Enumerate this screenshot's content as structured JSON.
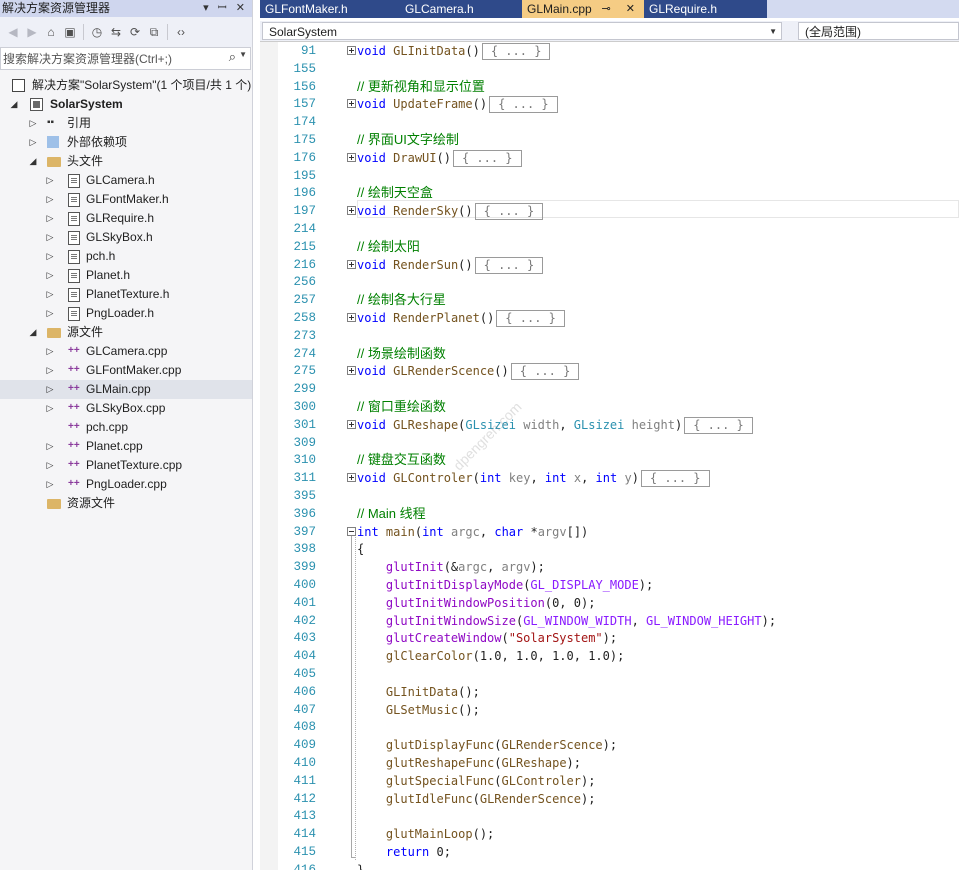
{
  "solution_explorer": {
    "title": "解决方案资源管理器",
    "title_buttons": [
      "▾",
      "ꟷ",
      "✕"
    ],
    "search_placeholder": "搜索解决方案资源管理器(Ctrl+;)",
    "tree": [
      {
        "label": "解决方案\"SolarSystem\"(1 个项目/共 1 个)",
        "depth": 0,
        "icon": "solution-icon",
        "arrow": ""
      },
      {
        "label": "SolarSystem",
        "depth": 1,
        "icon": "project-icon",
        "arrow": "◢",
        "bold": true
      },
      {
        "label": "引用",
        "depth": 2,
        "icon": "reference-icon",
        "arrow": "▷"
      },
      {
        "label": "外部依赖项",
        "depth": 2,
        "icon": "external-deps-icon",
        "arrow": "▷"
      },
      {
        "label": "头文件",
        "depth": 2,
        "icon": "folder-icon",
        "arrow": "◢"
      },
      {
        "label": "GLCamera.h",
        "depth": 3,
        "icon": "header-file-icon",
        "arrow": "▷"
      },
      {
        "label": "GLFontMaker.h",
        "depth": 3,
        "icon": "header-file-icon",
        "arrow": "▷"
      },
      {
        "label": "GLRequire.h",
        "depth": 3,
        "icon": "header-file-icon",
        "arrow": "▷"
      },
      {
        "label": "GLSkyBox.h",
        "depth": 3,
        "icon": "header-file-icon",
        "arrow": "▷"
      },
      {
        "label": "pch.h",
        "depth": 3,
        "icon": "header-file-icon",
        "arrow": "▷"
      },
      {
        "label": "Planet.h",
        "depth": 3,
        "icon": "header-file-icon",
        "arrow": "▷"
      },
      {
        "label": "PlanetTexture.h",
        "depth": 3,
        "icon": "header-file-icon",
        "arrow": "▷"
      },
      {
        "label": "PngLoader.h",
        "depth": 3,
        "icon": "header-file-icon",
        "arrow": "▷"
      },
      {
        "label": "源文件",
        "depth": 2,
        "icon": "folder-icon",
        "arrow": "◢"
      },
      {
        "label": "GLCamera.cpp",
        "depth": 3,
        "icon": "cpp-file-icon",
        "arrow": "▷"
      },
      {
        "label": "GLFontMaker.cpp",
        "depth": 3,
        "icon": "cpp-file-icon",
        "arrow": "▷"
      },
      {
        "label": "GLMain.cpp",
        "depth": 3,
        "icon": "cpp-file-icon",
        "arrow": "▷",
        "selected": true
      },
      {
        "label": "GLSkyBox.cpp",
        "depth": 3,
        "icon": "cpp-file-icon",
        "arrow": "▷"
      },
      {
        "label": "pch.cpp",
        "depth": 3,
        "icon": "cpp-file-icon",
        "arrow": ""
      },
      {
        "label": "Planet.cpp",
        "depth": 3,
        "icon": "cpp-file-icon",
        "arrow": "▷"
      },
      {
        "label": "PlanetTexture.cpp",
        "depth": 3,
        "icon": "cpp-file-icon",
        "arrow": "▷"
      },
      {
        "label": "PngLoader.cpp",
        "depth": 3,
        "icon": "cpp-file-icon",
        "arrow": "▷"
      },
      {
        "label": "资源文件",
        "depth": 2,
        "icon": "folder-icon",
        "arrow": ""
      }
    ]
  },
  "tabs": [
    {
      "label": "GLFontMaker.h",
      "active": false
    },
    {
      "label": "GLCamera.h",
      "active": false
    },
    {
      "label": "GLMain.cpp",
      "active": true
    },
    {
      "label": "GLRequire.h",
      "active": false
    }
  ],
  "active_tab_icons": "⊸ ✕",
  "navbar": {
    "project": "SolarSystem",
    "scope": "(全局范围)"
  },
  "watermark": "dpengren.com",
  "code_lines": [
    {
      "n": "91",
      "fold": "plus",
      "html": "<span class='kw'>void</span> <span class='fn'>GLInitData</span>()<span class='collapsed'>{ ... }</span>"
    },
    {
      "n": "155",
      "html": ""
    },
    {
      "n": "156",
      "html": "<span class='cm'>// 更新视角和显示位置</span>"
    },
    {
      "n": "157",
      "fold": "plus",
      "html": "<span class='kw'>void</span> <span class='fn'>UpdateFrame</span>()<span class='collapsed'>{ ... }</span>"
    },
    {
      "n": "174",
      "html": ""
    },
    {
      "n": "175",
      "html": "<span class='cm'>// 界面UI文字绘制</span>"
    },
    {
      "n": "176",
      "fold": "plus",
      "html": "<span class='kw'>void</span> <span class='fn'>DrawUI</span>()<span class='collapsed'>{ ... }</span>"
    },
    {
      "n": "195",
      "html": ""
    },
    {
      "n": "196",
      "html": "<span class='cm'>// 绘制天空盒</span>"
    },
    {
      "n": "197",
      "fold": "plus",
      "html": "<span class='kw'>void</span> <span class='fn'>RenderSky</span>()<span class='collapsed'>{ ... }</span>"
    },
    {
      "n": "214",
      "html": ""
    },
    {
      "n": "215",
      "html": "<span class='cm'>// 绘制太阳</span>"
    },
    {
      "n": "216",
      "fold": "plus",
      "html": "<span class='kw'>void</span> <span class='fn'>RenderSun</span>()<span class='collapsed'>{ ... }</span>"
    },
    {
      "n": "256",
      "html": ""
    },
    {
      "n": "257",
      "html": "<span class='cm'>// 绘制各大行星</span>"
    },
    {
      "n": "258",
      "fold": "plus",
      "html": "<span class='kw'>void</span> <span class='fn'>RenderPlanet</span>()<span class='collapsed'>{ ... }</span>"
    },
    {
      "n": "273",
      "html": ""
    },
    {
      "n": "274",
      "html": "<span class='cm'>// 场景绘制函数</span>"
    },
    {
      "n": "275",
      "fold": "plus",
      "html": "<span class='kw'>void</span> <span class='fn'>GLRenderScence</span>()<span class='collapsed'>{ ... }</span>"
    },
    {
      "n": "299",
      "html": ""
    },
    {
      "n": "300",
      "html": "<span class='cm'>// 窗口重绘函数</span>"
    },
    {
      "n": "301",
      "fold": "plus",
      "html": "<span class='kw'>void</span> <span class='fn'>GLReshape</span>(<span class='ty'>GLsizei</span> <span class='pm'>width</span>, <span class='ty'>GLsizei</span> <span class='pm'>height</span>)<span class='collapsed'>{ ... }</span>"
    },
    {
      "n": "309",
      "html": ""
    },
    {
      "n": "310",
      "html": "<span class='cm'>// 键盘交互函数</span>"
    },
    {
      "n": "311",
      "fold": "plus",
      "html": "<span class='kw'>void</span> <span class='fn'>GLControler</span>(<span class='kw'>int</span> <span class='pm'>key</span>, <span class='kw'>int</span> <span class='pm'>x</span>, <span class='kw'>int</span> <span class='pm'>y</span>)<span class='collapsed'>{ ... }</span>"
    },
    {
      "n": "395",
      "html": ""
    },
    {
      "n": "396",
      "html": "<span class='cm'>// Main 线程</span>"
    },
    {
      "n": "397",
      "fold": "minus",
      "html": "<span class='kw'>int</span> <span class='fn'>main</span>(<span class='kw'>int</span> <span class='pm'>argc</span>, <span class='kw'>char</span> *<span class='pm'>argv</span>[])"
    },
    {
      "n": "398",
      "html": "{"
    },
    {
      "n": "399",
      "html": "    <span class='fn-p'>glutInit</span>(&amp;<span class='pm'>argc</span>, <span class='pm'>argv</span>);"
    },
    {
      "n": "400",
      "html": "    <span class='fn-p'>glutInitDisplayMode</span>(<span class='mac'>GL_DISPLAY_MODE</span>);"
    },
    {
      "n": "401",
      "html": "    <span class='fn-p'>glutInitWindowPosition</span>(0, 0);"
    },
    {
      "n": "402",
      "html": "    <span class='fn-p'>glutInitWindowSize</span>(<span class='mac'>GL_WINDOW_WIDTH</span>, <span class='mac'>GL_WINDOW_HEIGHT</span>);"
    },
    {
      "n": "403",
      "html": "    <span class='fn-p'>glutCreateWindow</span>(<span class='str'>\"SolarSystem\"</span>);"
    },
    {
      "n": "404",
      "html": "    <span class='fn'>glClearColor</span>(1.0, 1.0, 1.0, 1.0);"
    },
    {
      "n": "405",
      "html": ""
    },
    {
      "n": "406",
      "html": "    <span class='fn'>GLInitData</span>();"
    },
    {
      "n": "407",
      "html": "    <span class='fn'>GLSetMusic</span>();"
    },
    {
      "n": "408",
      "html": ""
    },
    {
      "n": "409",
      "html": "    <span class='fn'>glutDisplayFunc</span>(<span class='fn'>GLRenderScence</span>);"
    },
    {
      "n": "410",
      "html": "    <span class='fn'>glutReshapeFunc</span>(<span class='fn'>GLReshape</span>);"
    },
    {
      "n": "411",
      "html": "    <span class='fn'>glutSpecialFunc</span>(<span class='fn'>GLControler</span>);"
    },
    {
      "n": "412",
      "html": "    <span class='fn'>glutIdleFunc</span>(<span class='fn'>GLRenderScence</span>);"
    },
    {
      "n": "413",
      "html": ""
    },
    {
      "n": "414",
      "html": "    <span class='fn'>glutMainLoop</span>();"
    },
    {
      "n": "415",
      "html": "    <span class='kw'>return</span> 0;"
    },
    {
      "n": "416",
      "html": "}"
    }
  ],
  "colors": {
    "accent_tab": "#f5cc84",
    "tab_inactive": "#2f4a8a",
    "line_number": "#2b91af",
    "comment": "#008000",
    "keyword": "#0000ff"
  }
}
